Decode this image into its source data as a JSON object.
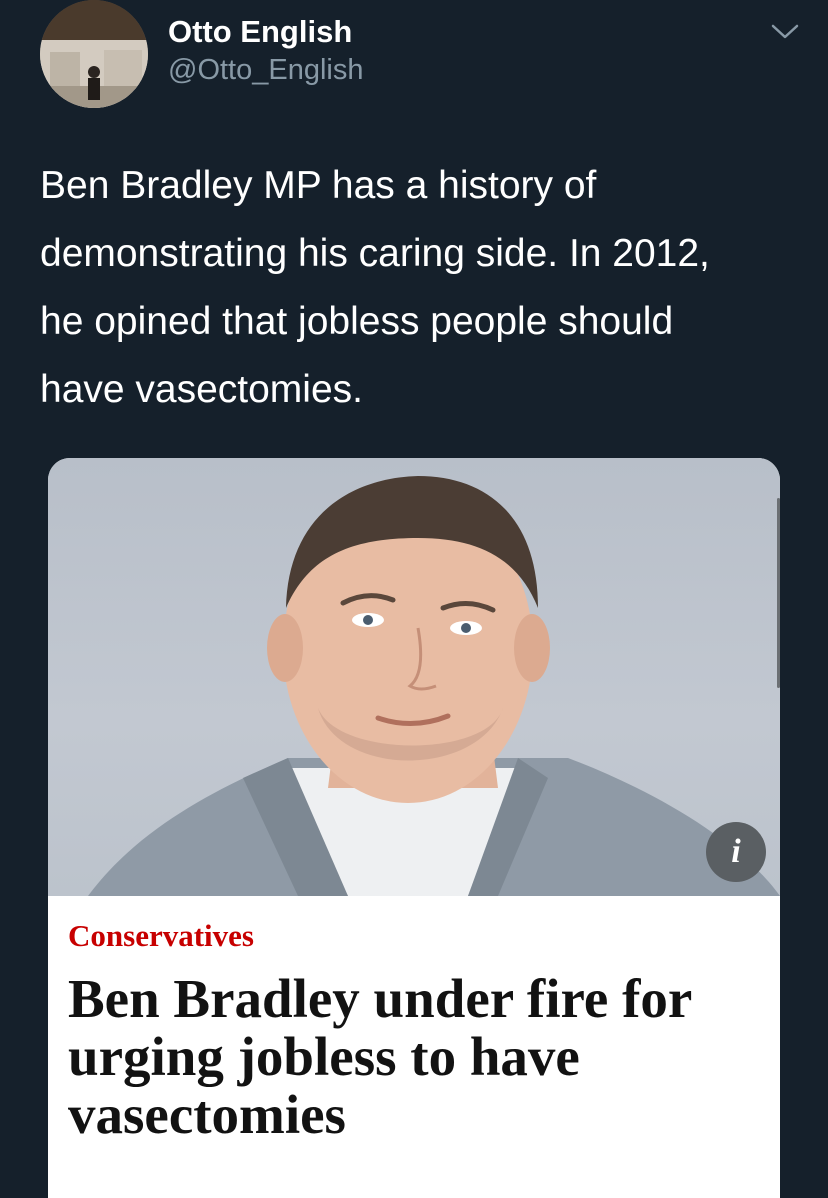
{
  "tweet": {
    "author_name": "Otto English",
    "author_handle": "@Otto_English",
    "text": "Ben Bradley MP has a history of\ndemonstrating his caring side. In 2012,\nhe opined that jobless people should\nhave vasectomies.",
    "menu_icon": "chevron-down-icon"
  },
  "card": {
    "kicker": "Conservatives",
    "headline": "Ben Bradley under fire for\nurging jobless to have\nvasectomies",
    "info_icon": "info-icon",
    "info_glyph": "i",
    "kicker_color": "#c70000"
  },
  "colors": {
    "background": "#15202b",
    "handle": "#8899a6"
  }
}
